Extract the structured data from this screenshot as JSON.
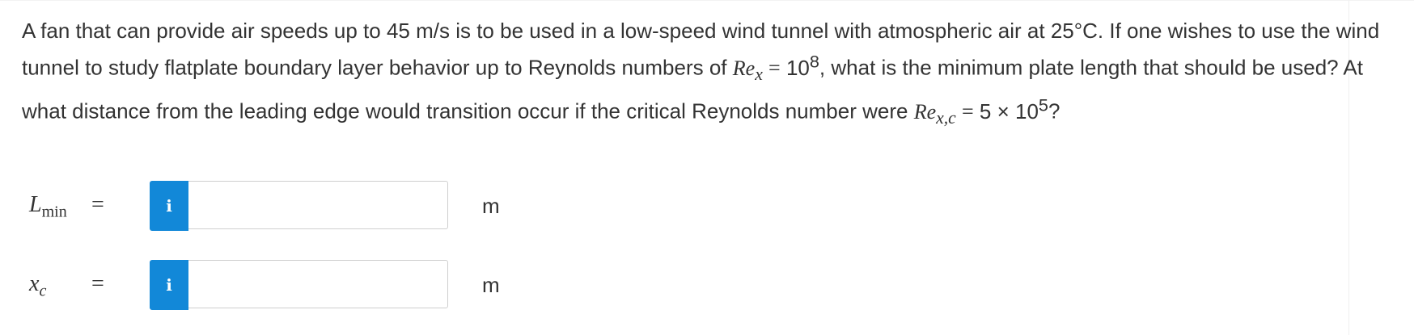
{
  "problem": {
    "part1": "A fan that can provide air speeds up to 45 m/s is to be used in a low-speed wind tunnel with atmospheric air at 25°C. If one wishes to use the wind tunnel to study flatplate boundary layer behavior up to Reynolds numbers of ",
    "re_x_symbol": "Re",
    "re_x_sub": "x",
    "eq1": "=",
    "re_value_base": "10",
    "re_value_exp": "8",
    "part2": ", what is the minimum plate length that should be used? At what distance from the leading edge would transition occur if the critical Reynolds number were ",
    "re_xc_symbol": "Re",
    "re_xc_sub": "x,c",
    "eq2": "=",
    "re_xc_value_base": "5 × 10",
    "re_xc_value_exp": "5",
    "part3": "?"
  },
  "answers": [
    {
      "symbol": "L",
      "sub": "min",
      "equals": "=",
      "info_label": "i",
      "value": "",
      "unit": "m"
    },
    {
      "symbol": "x",
      "sub": "c",
      "equals": "=",
      "info_label": "i",
      "value": "",
      "unit": "m"
    }
  ],
  "colors": {
    "info_button": "#1288d8",
    "text": "#333333",
    "input_border": "#cfcfcf"
  }
}
